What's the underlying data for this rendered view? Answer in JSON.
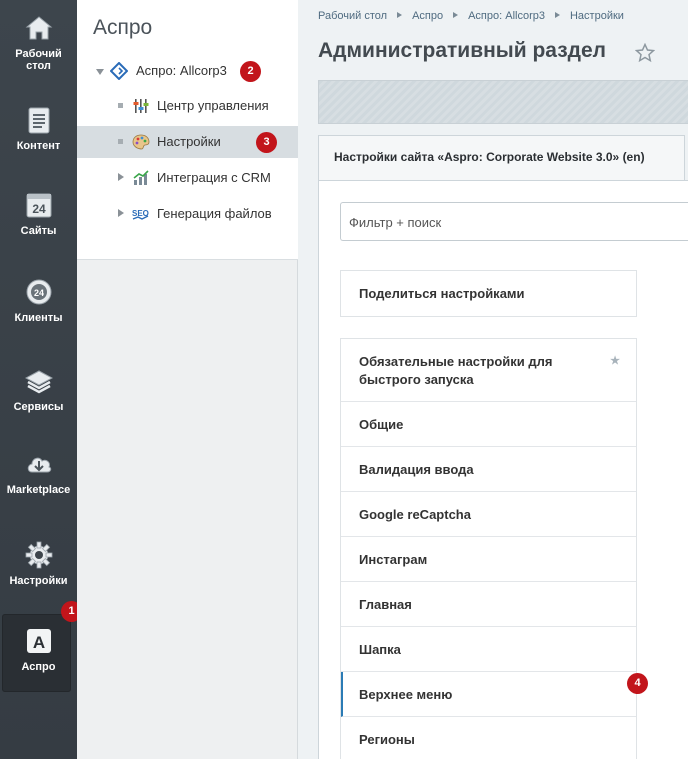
{
  "leftbar": {
    "items": [
      {
        "label": "Рабочий стол",
        "icon": "home-icon"
      },
      {
        "label": "Контент",
        "icon": "document-icon"
      },
      {
        "label": "Сайты",
        "icon": "calendar-24-icon"
      },
      {
        "label": "Клиенты",
        "icon": "clients-24-icon"
      },
      {
        "label": "Сервисы",
        "icon": "layers-icon"
      },
      {
        "label": "Marketplace",
        "icon": "cloud-download-icon"
      },
      {
        "label": "Настройки",
        "icon": "gear-icon"
      },
      {
        "label": "Аспро",
        "icon": "aspro-a-icon"
      }
    ]
  },
  "menu2": {
    "title": "Аспро",
    "items": [
      {
        "label": "Аспро: Allcorp3"
      },
      {
        "label": "Центр управления"
      },
      {
        "label": "Настройки"
      },
      {
        "label": "Интеграция с CRM"
      },
      {
        "label": "Генерация файлов"
      }
    ]
  },
  "breadcrumb": [
    "Рабочий стол",
    "Аспро",
    "Аспро: Allcorp3",
    "Настройки"
  ],
  "page_title": "Административный раздел",
  "tab_label": "Настройки сайта «Aspro: Corporate Website 3.0» (en)",
  "filter_placeholder": "Фильтр + поиск",
  "share_label": "Поделиться настройками",
  "settings_list": [
    "Обязательные настройки для быстрого запуска",
    "Общие",
    "Валидация ввода",
    "Google reCaptcha",
    "Инстаграм",
    "Главная",
    "Шапка",
    "Верхнее меню",
    "Регионы"
  ],
  "badges": [
    "1",
    "2",
    "3",
    "4"
  ],
  "colors": {
    "badge": "#c2151b",
    "leftbar": "#3d454c",
    "active_marker": "#2b7bb5"
  }
}
